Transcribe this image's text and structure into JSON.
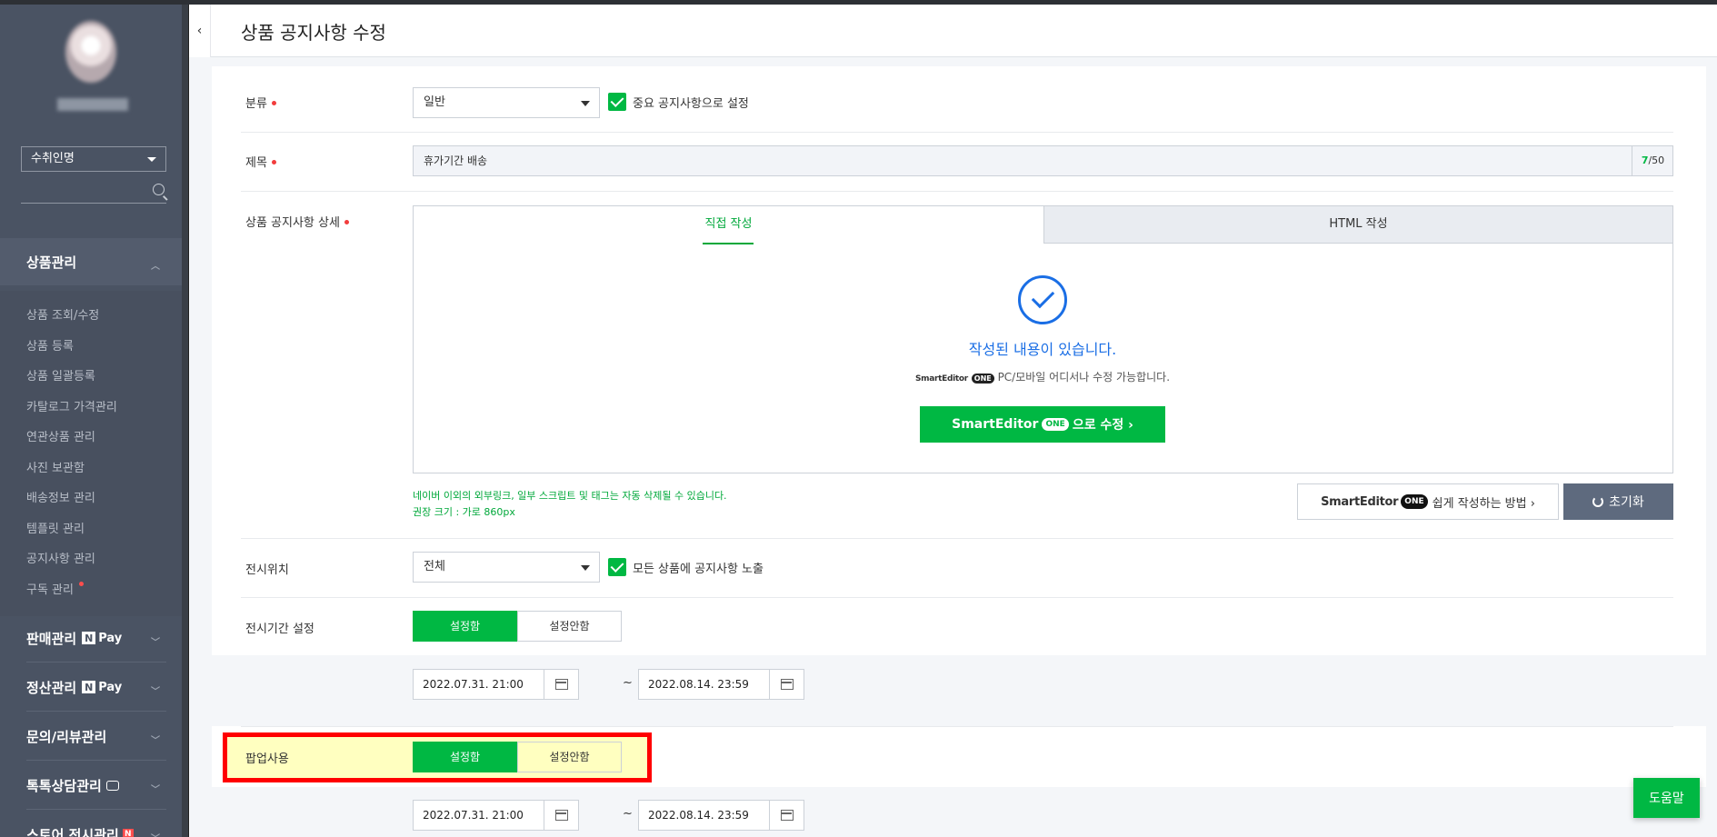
{
  "page": {
    "title": "상품 공지사항 수정"
  },
  "sidebar": {
    "store_select": "수취인명",
    "sections": [
      {
        "label": "상품관리"
      },
      {
        "label": "판매관리",
        "badge": "Pay"
      },
      {
        "label": "정산관리",
        "badge": "Pay"
      },
      {
        "label": "문의/리뷰관리"
      },
      {
        "label": "톡톡상담관리"
      },
      {
        "label": "스토어 전시관리"
      }
    ],
    "badge_n": "N",
    "items": [
      {
        "label": "상품 조회/수정"
      },
      {
        "label": "상품 등록"
      },
      {
        "label": "상품 일괄등록"
      },
      {
        "label": "카탈로그 가격관리"
      },
      {
        "label": "연관상품 관리"
      },
      {
        "label": "사진 보관함"
      },
      {
        "label": "배송정보 관리"
      },
      {
        "label": "템플릿 관리"
      },
      {
        "label": "공지사항 관리"
      },
      {
        "label": "구독 관리"
      }
    ]
  },
  "form": {
    "category": {
      "label": "분류",
      "value": "일반",
      "important_label": "중요 공지사항으로 설정"
    },
    "title": {
      "label": "제목",
      "value": "휴가기간 배송",
      "count_current": "7",
      "count_max": "/50"
    },
    "detail": {
      "label": "상품 공지사항 상세",
      "tab_direct": "직접 작성",
      "tab_html": "HTML 작성",
      "written_msg": "작성된 내용이 있습니다.",
      "se_logo": "SmartEditor",
      "one": "ONE",
      "edit_sub": "PC/모바일 어디서나 수정 가능합니다.",
      "edit_btn_suffix": "으로 수정 ›",
      "warn1": "네이버 이외의 외부링크, 일부 스크립트 및 태그는 자동 삭제될 수 있습니다.",
      "warn2": "권장 크기 : 가로 860px",
      "howto_label": "쉽게 작성하는 방법 ›",
      "reset_label": "초기화"
    },
    "display_position": {
      "label": "전시위치",
      "value": "전체",
      "expose_label": "모든 상품에 공지사항 노출"
    },
    "display_period": {
      "label": "전시기간 설정",
      "on": "설정함",
      "off": "설정안함",
      "start": "2022.07.31. 21:00",
      "end": "2022.08.14. 23:59",
      "tilde": "~"
    },
    "popup": {
      "label": "팝업사용",
      "on": "설정함",
      "off": "설정안함",
      "start": "2022.07.31. 21:00",
      "end": "2022.08.14. 23:59",
      "tilde": "~"
    }
  },
  "help": {
    "label": "도움말"
  },
  "colors": {
    "accent": "#00b843",
    "blue": "#1a6ee5",
    "sidebar": "#4a5363",
    "highlight_border": "#ff0000",
    "highlight_bg": "#ffffc0"
  }
}
